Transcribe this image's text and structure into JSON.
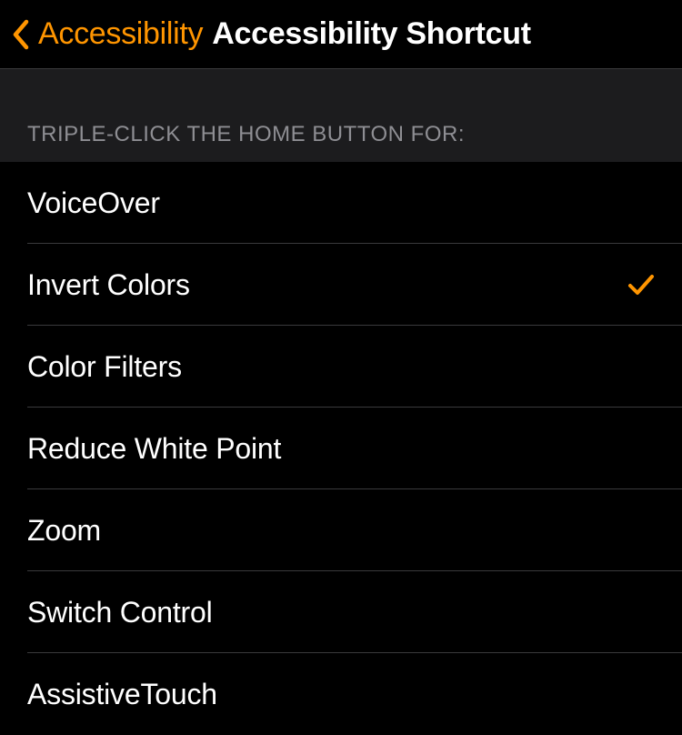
{
  "nav": {
    "back_label": "Accessibility",
    "title": "Accessibility Shortcut"
  },
  "section": {
    "header": "TRIPLE-CLICK THE HOME BUTTON FOR:"
  },
  "options": [
    {
      "label": "VoiceOver",
      "selected": false
    },
    {
      "label": "Invert Colors",
      "selected": true
    },
    {
      "label": "Color Filters",
      "selected": false
    },
    {
      "label": "Reduce White Point",
      "selected": false
    },
    {
      "label": "Zoom",
      "selected": false
    },
    {
      "label": "Switch Control",
      "selected": false
    },
    {
      "label": "AssistiveTouch",
      "selected": false
    }
  ],
  "colors": {
    "accent": "#ff9500"
  }
}
